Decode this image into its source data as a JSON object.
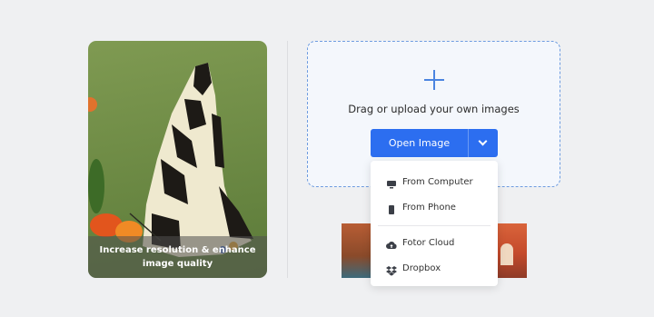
{
  "feature_card": {
    "caption": "Increase resolution & enhance image quality"
  },
  "upload_area": {
    "hint": "Drag or upload your own images",
    "open_button_label": "Open Image"
  },
  "dropdown": {
    "items": [
      {
        "label": "From Computer",
        "icon": "computer-icon"
      },
      {
        "label": "From Phone",
        "icon": "phone-icon"
      },
      {
        "label": "Fotor Cloud",
        "icon": "cloud-upload-icon"
      },
      {
        "label": "Dropbox",
        "icon": "dropbox-icon"
      }
    ]
  },
  "colors": {
    "accent": "#2c6ef0",
    "upload_border": "#6e9ce0",
    "background": "#eff0f2"
  }
}
